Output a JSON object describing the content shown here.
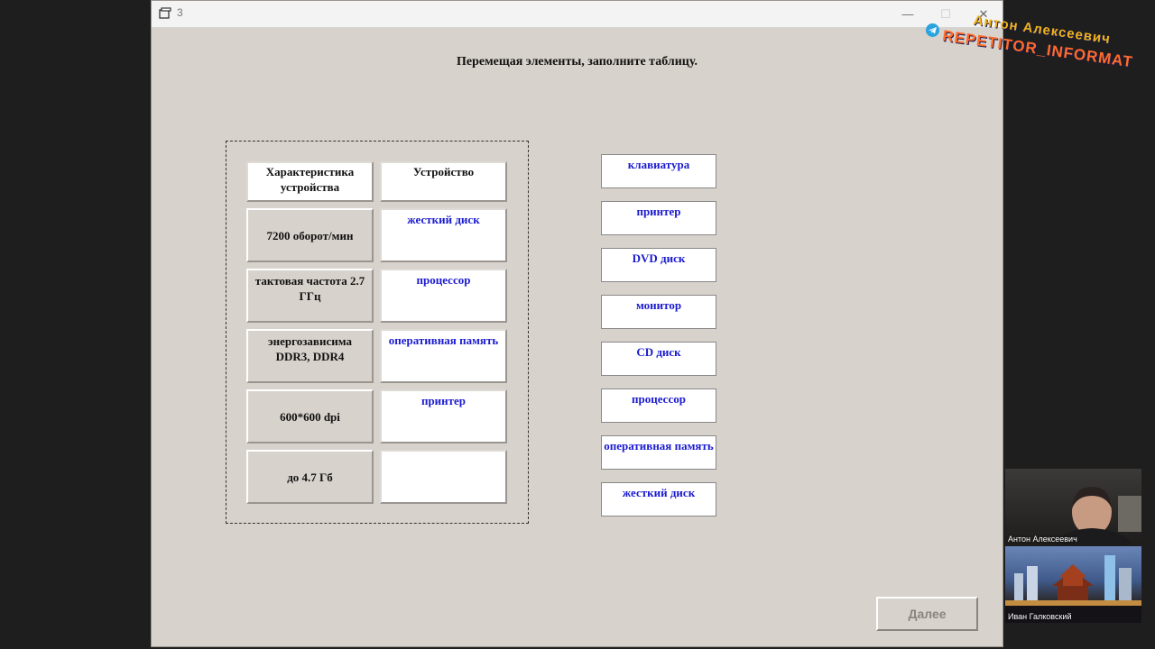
{
  "window": {
    "title": "3",
    "controls": {
      "minimize": "—",
      "maximize": "☐",
      "close": "✕"
    }
  },
  "instruction": "Перемещая элементы, заполните таблицу.",
  "table": {
    "headers": [
      "Характеристика устройства",
      "Устройство"
    ],
    "rows": [
      {
        "characteristic": "7200 оборот/мин",
        "device": "жесткий диск"
      },
      {
        "characteristic": "тактовая частота 2.7 ГГц",
        "device": "процессор"
      },
      {
        "characteristic": "энергозависима DDR3, DDR4",
        "device": "оперативная память"
      },
      {
        "characteristic": "600*600 dpi",
        "device": "принтер"
      },
      {
        "characteristic": "до 4.7 Гб",
        "device": ""
      }
    ]
  },
  "options": [
    "клавиатура",
    "принтер",
    "DVD диск",
    "монитор",
    "CD диск",
    "процессор",
    "оперативная память",
    "жесткий диск"
  ],
  "next_button": "Далее",
  "watermark": {
    "name": "Антон Алексеевич",
    "handle": "REPETITOR_INFORMAT"
  },
  "participants": [
    "Антон Алексеевич",
    "Иван Галковский"
  ],
  "colors": {
    "device_text": "#1a1ad0",
    "window_bg": "#d8d2cc"
  }
}
